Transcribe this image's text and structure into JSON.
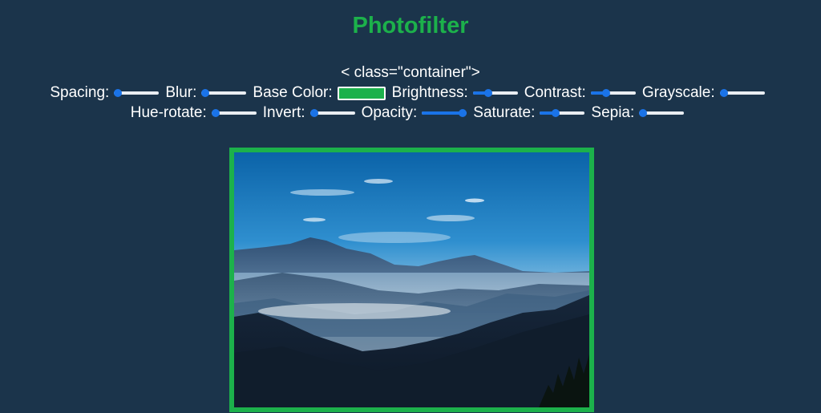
{
  "title": "Photofilter",
  "container_text": "< class=\"container\">",
  "colors": {
    "background": "#1b344b",
    "accent": "#1cb14b",
    "slider_accent": "#1a73e8"
  },
  "controls_row1": [
    {
      "label": "Spacing:",
      "type": "range",
      "value": 0.0
    },
    {
      "label": "Blur:",
      "type": "range",
      "value": 0.0
    },
    {
      "label": "Base Color:",
      "type": "color",
      "value": "#1cb14b"
    },
    {
      "label": "Brightness:",
      "type": "range",
      "value": 0.35
    },
    {
      "label": "Contrast:",
      "type": "range",
      "value": 0.35
    },
    {
      "label": "Grayscale:",
      "type": "range",
      "value": 0.0
    }
  ],
  "controls_row2": [
    {
      "label": "Hue-rotate:",
      "type": "range",
      "value": 0.0
    },
    {
      "label": "Invert:",
      "type": "range",
      "value": 0.0
    },
    {
      "label": "Opacity:",
      "type": "range",
      "value": 1.0
    },
    {
      "label": "Saturate:",
      "type": "range",
      "value": 0.35
    },
    {
      "label": "Sepia:",
      "type": "range",
      "value": 0.0
    }
  ],
  "photo": {
    "subject": "mountain landscape with blue sky and valley fog"
  }
}
